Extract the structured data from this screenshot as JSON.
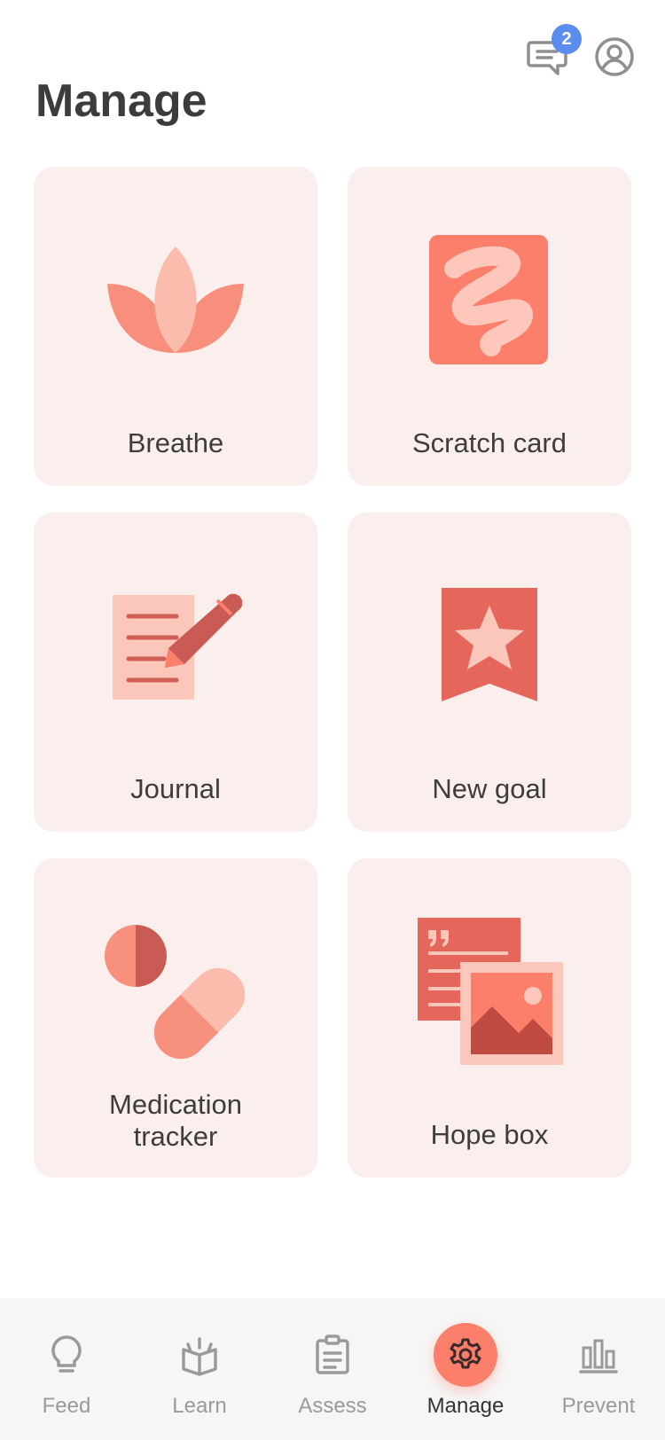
{
  "header": {
    "title": "Manage",
    "messages_badge": "2",
    "messages_icon": "chat-icon",
    "profile_icon": "account-icon"
  },
  "cards": [
    {
      "label": "Breathe",
      "icon": "lotus-icon"
    },
    {
      "label": "Scratch card",
      "icon": "scribble-icon"
    },
    {
      "label": "Journal",
      "icon": "journal-pencil-icon"
    },
    {
      "label": "New goal",
      "icon": "bookmark-star-icon"
    },
    {
      "label_line1": "Medication",
      "label_line2": "tracker",
      "icon": "pill-icon"
    },
    {
      "label": "Hope box",
      "icon": "quote-photo-icon"
    }
  ],
  "tabs": [
    {
      "label": "Feed",
      "icon": "lightbulb-icon"
    },
    {
      "label": "Learn",
      "icon": "open-book-icon"
    },
    {
      "label": "Assess",
      "icon": "clipboard-icon"
    },
    {
      "label": "Manage",
      "icon": "gear-icon",
      "active": true
    },
    {
      "label": "Prevent",
      "icon": "bar-chart-icon"
    }
  ],
  "colors": {
    "accent": "#fb7f6b",
    "card_bg": "#fbefed",
    "badge": "#5b8def"
  }
}
